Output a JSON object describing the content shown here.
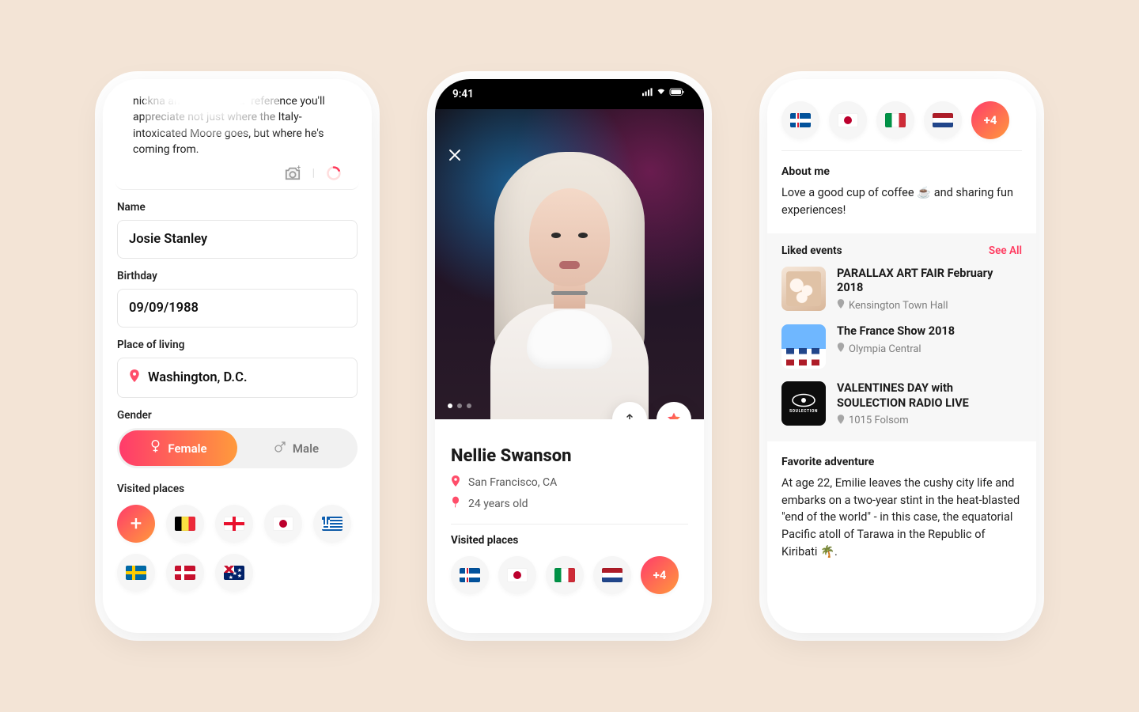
{
  "colors": {
    "accent_gradient_from": "#ff3b6b",
    "accent_gradient_to": "#ff9a3c",
    "accent": "#ff3a5f"
  },
  "phone1": {
    "bio_snippet": "nickna                                      and the \"Sophia\" reference you'll appreciate not just where the Italy-intoxicated Moore goes, but where he's coming from.",
    "name_label": "Name",
    "name_value": "Josie Stanley",
    "birthday_label": "Birthday",
    "birthday_value": "09/09/1988",
    "place_label": "Place of living",
    "place_value": "Washington, D.C.",
    "gender_label": "Gender",
    "gender_female": "Female",
    "gender_male": "Male",
    "visited_label": "Visited places",
    "flags": [
      "add",
      "be",
      "ge",
      "jp",
      "gr",
      "se",
      "dk",
      "au"
    ]
  },
  "phone2": {
    "status_time": "9:41",
    "name": "Nellie Swanson",
    "location": "San Francisco, CA",
    "age": "24 years old",
    "visited_label": "Visited places",
    "flags": [
      "is",
      "jp",
      "it",
      "nl"
    ],
    "more_count": "+4"
  },
  "phone3": {
    "flags": [
      "is",
      "jp",
      "it",
      "nl"
    ],
    "more_count": "+4",
    "about_label": "About me",
    "about_text": "Love a good cup of coffee ☕ and sharing fun experiences!",
    "liked_label": "Liked events",
    "see_all": "See All",
    "events": [
      {
        "title": "PARALLAX ART FAIR February 2018",
        "location": "Kensington Town Hall"
      },
      {
        "title": "The France Show 2018",
        "location": "Olympia Central"
      },
      {
        "title": "VALENTINES DAY with SOULECTION RADIO LIVE",
        "location": "1015 Folsom"
      }
    ],
    "fav_label": "Favorite adventure",
    "fav_text": "At age 22, Emilie leaves the cushy city life and embarks on a two-year stint in the heat-blasted \"end of the world\" - in this case, the equatorial Pacific atoll of Tarawa in the Republic of Kiribati 🌴."
  }
}
